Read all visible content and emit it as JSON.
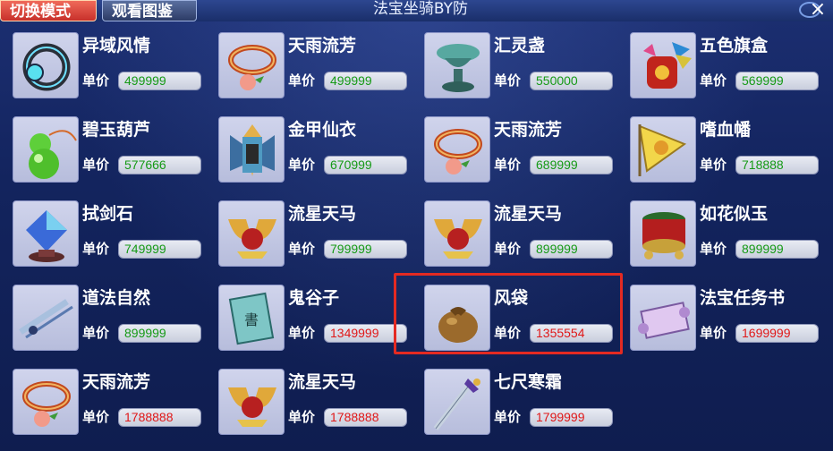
{
  "tabs": {
    "mode": "切换模式",
    "book": "观看图鉴"
  },
  "title": "法宝坐骑BY防",
  "close_glyph": "×",
  "price_label": "单价",
  "items": [
    {
      "name": "异域风情",
      "price": "499999",
      "color": "green",
      "icon": "ring-icon"
    },
    {
      "name": "天雨流芳",
      "price": "499999",
      "color": "green",
      "icon": "bracelet-icon"
    },
    {
      "name": "汇灵盏",
      "price": "550000",
      "color": "green",
      "icon": "cup-icon"
    },
    {
      "name": "五色旗盒",
      "price": "569999",
      "color": "green",
      "icon": "flag-box-icon"
    },
    {
      "name": "碧玉葫芦",
      "price": "577666",
      "color": "green",
      "icon": "gourd-icon"
    },
    {
      "name": "金甲仙衣",
      "price": "670999",
      "color": "green",
      "icon": "armor-icon"
    },
    {
      "name": "天雨流芳",
      "price": "689999",
      "color": "green",
      "icon": "bracelet-icon"
    },
    {
      "name": "嗜血幡",
      "price": "718888",
      "color": "green",
      "icon": "banner-icon"
    },
    {
      "name": "拭剑石",
      "price": "749999",
      "color": "green",
      "icon": "gem-icon"
    },
    {
      "name": "流星天马",
      "price": "799999",
      "color": "green",
      "icon": "winged-horse-icon"
    },
    {
      "name": "流星天马",
      "price": "899999",
      "color": "green",
      "icon": "winged-horse-icon"
    },
    {
      "name": "如花似玉",
      "price": "899999",
      "color": "green",
      "icon": "drum-icon"
    },
    {
      "name": "道法自然",
      "price": "899999",
      "color": "green",
      "icon": "scroll-sword-icon"
    },
    {
      "name": "鬼谷子",
      "price": "1349999",
      "color": "red",
      "icon": "book-icon"
    },
    {
      "name": "风袋",
      "price": "1355554",
      "color": "red",
      "icon": "bag-icon"
    },
    {
      "name": "法宝任务书",
      "price": "1699999",
      "color": "red",
      "icon": "scroll-icon"
    },
    {
      "name": "天雨流芳",
      "price": "1788888",
      "color": "red",
      "icon": "bracelet-icon"
    },
    {
      "name": "流星天马",
      "price": "1788888",
      "color": "red",
      "icon": "winged-horse-icon"
    },
    {
      "name": "七尺寒霜",
      "price": "1799999",
      "color": "red",
      "icon": "dagger-icon"
    }
  ],
  "selected_item": "风袋"
}
